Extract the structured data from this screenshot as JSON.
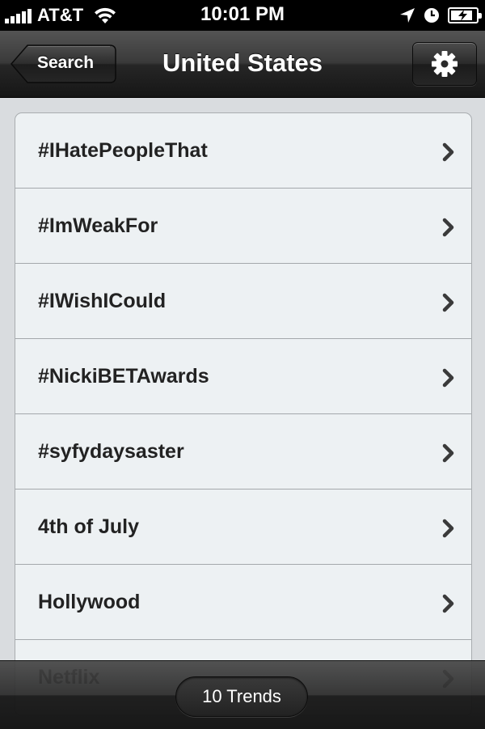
{
  "status_bar": {
    "carrier": "AT&T",
    "time": "10:01 PM",
    "signal_bars": 5,
    "battery_level": 0.85,
    "icons": [
      "signal-icon",
      "wifi-icon",
      "location-arrow-icon",
      "clock-icon",
      "battery-charging-icon"
    ]
  },
  "nav": {
    "title": "United States",
    "back_label": "Search",
    "settings_icon": "gear-icon"
  },
  "trends": [
    {
      "label": "#IHatePeopleThat"
    },
    {
      "label": "#ImWeakFor"
    },
    {
      "label": "#IWishICould"
    },
    {
      "label": "#NickiBETAwards"
    },
    {
      "label": "#syfydaysaster"
    },
    {
      "label": "4th of July"
    },
    {
      "label": "Hollywood"
    },
    {
      "label": "Netflix"
    }
  ],
  "toolbar": {
    "count_label": "10 Trends"
  },
  "colors": {
    "background": "#d9dcdf",
    "row_background": "#edf1f3",
    "text": "#222222"
  }
}
